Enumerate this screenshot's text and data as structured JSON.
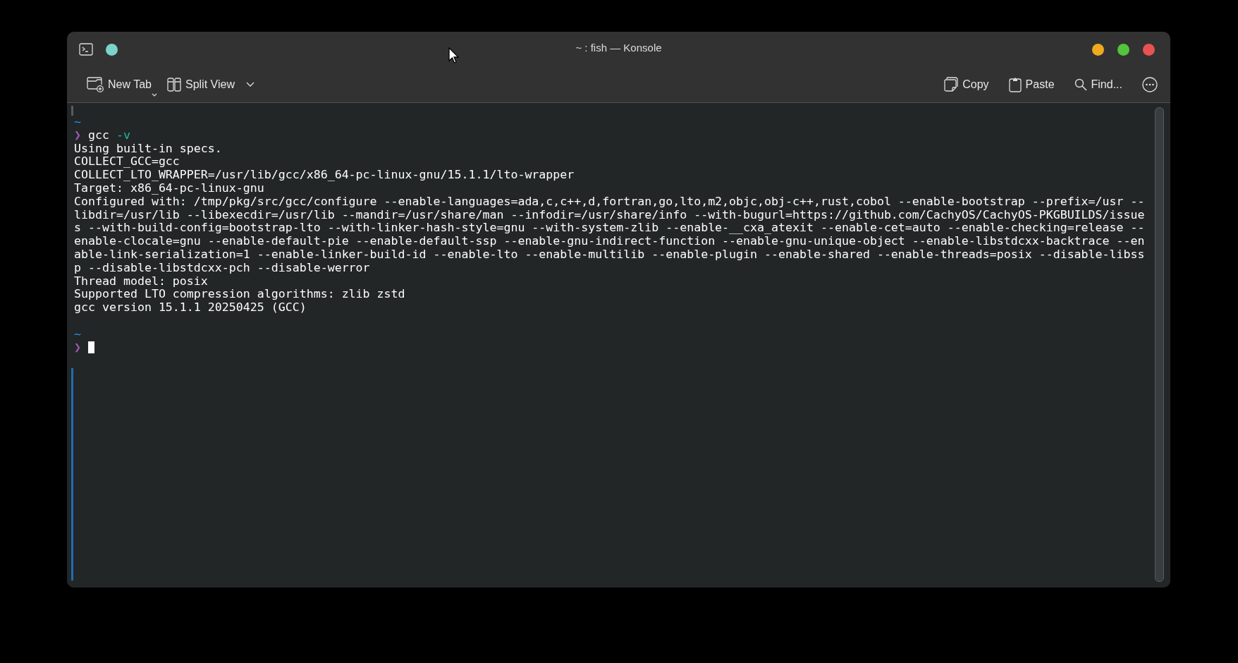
{
  "window": {
    "title": "~ : fish — Konsole"
  },
  "toolbar": {
    "left": [
      {
        "kind": "new-tab",
        "label": "New Tab"
      },
      {
        "kind": "split",
        "label": "Split View"
      }
    ],
    "right": [
      {
        "kind": "copy",
        "label": "Copy"
      },
      {
        "kind": "paste",
        "label": "Paste"
      },
      {
        "kind": "find",
        "label": "Find..."
      },
      {
        "kind": "more"
      }
    ]
  },
  "terminal": {
    "lines": [
      {
        "kind": "dir",
        "text": "~"
      },
      {
        "kind": "command",
        "symbol": "❯",
        "command": "gcc",
        "args": "-v"
      },
      {
        "kind": "output",
        "text": "Using built-in specs."
      },
      {
        "kind": "output",
        "text": "COLLECT_GCC=gcc"
      },
      {
        "kind": "output",
        "text": "COLLECT_LTO_WRAPPER=/usr/lib/gcc/x86_64-pc-linux-gnu/15.1.1/lto-wrapper"
      },
      {
        "kind": "output",
        "text": "Target: x86_64-pc-linux-gnu"
      },
      {
        "kind": "output",
        "text": "Configured with: /tmp/pkg/src/gcc/configure --enable-languages=ada,c,c++,d,fortran,go,lto,m2,objc,obj-c++,rust,cobol --enable-bootstrap --prefix=/usr --"
      },
      {
        "kind": "output",
        "text": "libdir=/usr/lib --libexecdir=/usr/lib --mandir=/usr/share/man --infodir=/usr/share/info --with-bugurl=https://github.com/CachyOS/CachyOS-PKGBUILDS/issue"
      },
      {
        "kind": "output",
        "text": "s --with-build-config=bootstrap-lto --with-linker-hash-style=gnu --with-system-zlib --enable-__cxa_atexit --enable-cet=auto --enable-checking=release --"
      },
      {
        "kind": "output",
        "text": "enable-clocale=gnu --enable-default-pie --enable-default-ssp --enable-gnu-indirect-function --enable-gnu-unique-object --enable-libstdcxx-backtrace --en"
      },
      {
        "kind": "output",
        "text": "able-link-serialization=1 --enable-linker-build-id --enable-lto --enable-multilib --enable-plugin --enable-shared --enable-threads=posix --disable-libss"
      },
      {
        "kind": "output",
        "text": "p --disable-libstdcxx-pch --disable-werror"
      },
      {
        "kind": "output",
        "text": "Thread model: posix"
      },
      {
        "kind": "output",
        "text": "Supported LTO compression algorithms: zlib zstd"
      },
      {
        "kind": "output",
        "text": "gcc version 15.1.1 20250425 (GCC)"
      },
      {
        "kind": "blank"
      },
      {
        "kind": "dir",
        "text": "~"
      },
      {
        "kind": "input",
        "symbol": "❯"
      }
    ]
  }
}
